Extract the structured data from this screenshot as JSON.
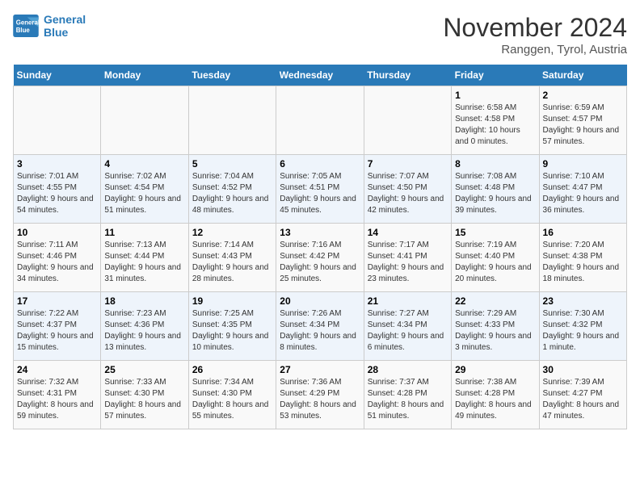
{
  "header": {
    "logo_line1": "General",
    "logo_line2": "Blue",
    "month_title": "November 2024",
    "location": "Ranggen, Tyrol, Austria"
  },
  "weekdays": [
    "Sunday",
    "Monday",
    "Tuesday",
    "Wednesday",
    "Thursday",
    "Friday",
    "Saturday"
  ],
  "weeks": [
    [
      {
        "day": "",
        "info": ""
      },
      {
        "day": "",
        "info": ""
      },
      {
        "day": "",
        "info": ""
      },
      {
        "day": "",
        "info": ""
      },
      {
        "day": "",
        "info": ""
      },
      {
        "day": "1",
        "info": "Sunrise: 6:58 AM\nSunset: 4:58 PM\nDaylight: 10 hours and 0 minutes."
      },
      {
        "day": "2",
        "info": "Sunrise: 6:59 AM\nSunset: 4:57 PM\nDaylight: 9 hours and 57 minutes."
      }
    ],
    [
      {
        "day": "3",
        "info": "Sunrise: 7:01 AM\nSunset: 4:55 PM\nDaylight: 9 hours and 54 minutes."
      },
      {
        "day": "4",
        "info": "Sunrise: 7:02 AM\nSunset: 4:54 PM\nDaylight: 9 hours and 51 minutes."
      },
      {
        "day": "5",
        "info": "Sunrise: 7:04 AM\nSunset: 4:52 PM\nDaylight: 9 hours and 48 minutes."
      },
      {
        "day": "6",
        "info": "Sunrise: 7:05 AM\nSunset: 4:51 PM\nDaylight: 9 hours and 45 minutes."
      },
      {
        "day": "7",
        "info": "Sunrise: 7:07 AM\nSunset: 4:50 PM\nDaylight: 9 hours and 42 minutes."
      },
      {
        "day": "8",
        "info": "Sunrise: 7:08 AM\nSunset: 4:48 PM\nDaylight: 9 hours and 39 minutes."
      },
      {
        "day": "9",
        "info": "Sunrise: 7:10 AM\nSunset: 4:47 PM\nDaylight: 9 hours and 36 minutes."
      }
    ],
    [
      {
        "day": "10",
        "info": "Sunrise: 7:11 AM\nSunset: 4:46 PM\nDaylight: 9 hours and 34 minutes."
      },
      {
        "day": "11",
        "info": "Sunrise: 7:13 AM\nSunset: 4:44 PM\nDaylight: 9 hours and 31 minutes."
      },
      {
        "day": "12",
        "info": "Sunrise: 7:14 AM\nSunset: 4:43 PM\nDaylight: 9 hours and 28 minutes."
      },
      {
        "day": "13",
        "info": "Sunrise: 7:16 AM\nSunset: 4:42 PM\nDaylight: 9 hours and 25 minutes."
      },
      {
        "day": "14",
        "info": "Sunrise: 7:17 AM\nSunset: 4:41 PM\nDaylight: 9 hours and 23 minutes."
      },
      {
        "day": "15",
        "info": "Sunrise: 7:19 AM\nSunset: 4:40 PM\nDaylight: 9 hours and 20 minutes."
      },
      {
        "day": "16",
        "info": "Sunrise: 7:20 AM\nSunset: 4:38 PM\nDaylight: 9 hours and 18 minutes."
      }
    ],
    [
      {
        "day": "17",
        "info": "Sunrise: 7:22 AM\nSunset: 4:37 PM\nDaylight: 9 hours and 15 minutes."
      },
      {
        "day": "18",
        "info": "Sunrise: 7:23 AM\nSunset: 4:36 PM\nDaylight: 9 hours and 13 minutes."
      },
      {
        "day": "19",
        "info": "Sunrise: 7:25 AM\nSunset: 4:35 PM\nDaylight: 9 hours and 10 minutes."
      },
      {
        "day": "20",
        "info": "Sunrise: 7:26 AM\nSunset: 4:34 PM\nDaylight: 9 hours and 8 minutes."
      },
      {
        "day": "21",
        "info": "Sunrise: 7:27 AM\nSunset: 4:34 PM\nDaylight: 9 hours and 6 minutes."
      },
      {
        "day": "22",
        "info": "Sunrise: 7:29 AM\nSunset: 4:33 PM\nDaylight: 9 hours and 3 minutes."
      },
      {
        "day": "23",
        "info": "Sunrise: 7:30 AM\nSunset: 4:32 PM\nDaylight: 9 hours and 1 minute."
      }
    ],
    [
      {
        "day": "24",
        "info": "Sunrise: 7:32 AM\nSunset: 4:31 PM\nDaylight: 8 hours and 59 minutes."
      },
      {
        "day": "25",
        "info": "Sunrise: 7:33 AM\nSunset: 4:30 PM\nDaylight: 8 hours and 57 minutes."
      },
      {
        "day": "26",
        "info": "Sunrise: 7:34 AM\nSunset: 4:30 PM\nDaylight: 8 hours and 55 minutes."
      },
      {
        "day": "27",
        "info": "Sunrise: 7:36 AM\nSunset: 4:29 PM\nDaylight: 8 hours and 53 minutes."
      },
      {
        "day": "28",
        "info": "Sunrise: 7:37 AM\nSunset: 4:28 PM\nDaylight: 8 hours and 51 minutes."
      },
      {
        "day": "29",
        "info": "Sunrise: 7:38 AM\nSunset: 4:28 PM\nDaylight: 8 hours and 49 minutes."
      },
      {
        "day": "30",
        "info": "Sunrise: 7:39 AM\nSunset: 4:27 PM\nDaylight: 8 hours and 47 minutes."
      }
    ]
  ]
}
